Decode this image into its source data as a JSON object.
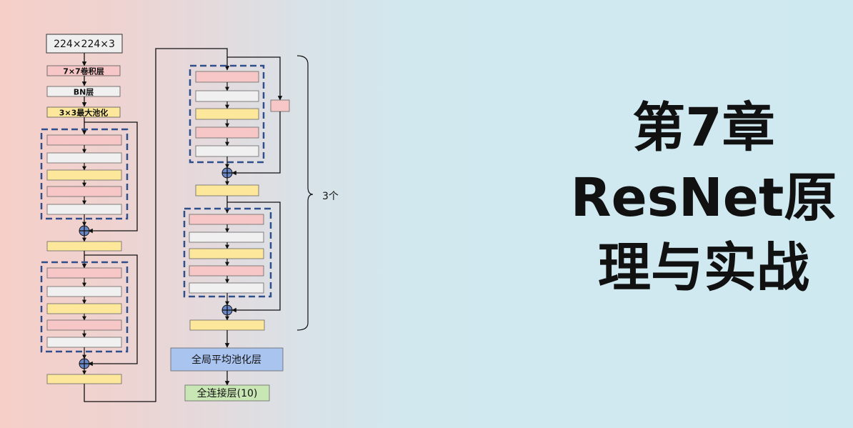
{
  "diagram": {
    "input_label": "224×224×3",
    "conv_label": "7×7卷积层",
    "bn_label": "BN层",
    "pool_label": "3×3最大池化",
    "repeat_label": "3个",
    "gap_label": "全局平均池化层",
    "fc_label": "全连接层(10)"
  },
  "title": {
    "line1": "第7章",
    "line2": "ResNet原",
    "line3": "理与实战"
  },
  "colors": {
    "pink": "#f7c6c6",
    "yellow": "#fde79a",
    "white": "#f0f0f0",
    "dashed_border": "#2f4e8c",
    "gap_fill": "#a9c4ef",
    "fc_fill": "#c9e6b5"
  }
}
